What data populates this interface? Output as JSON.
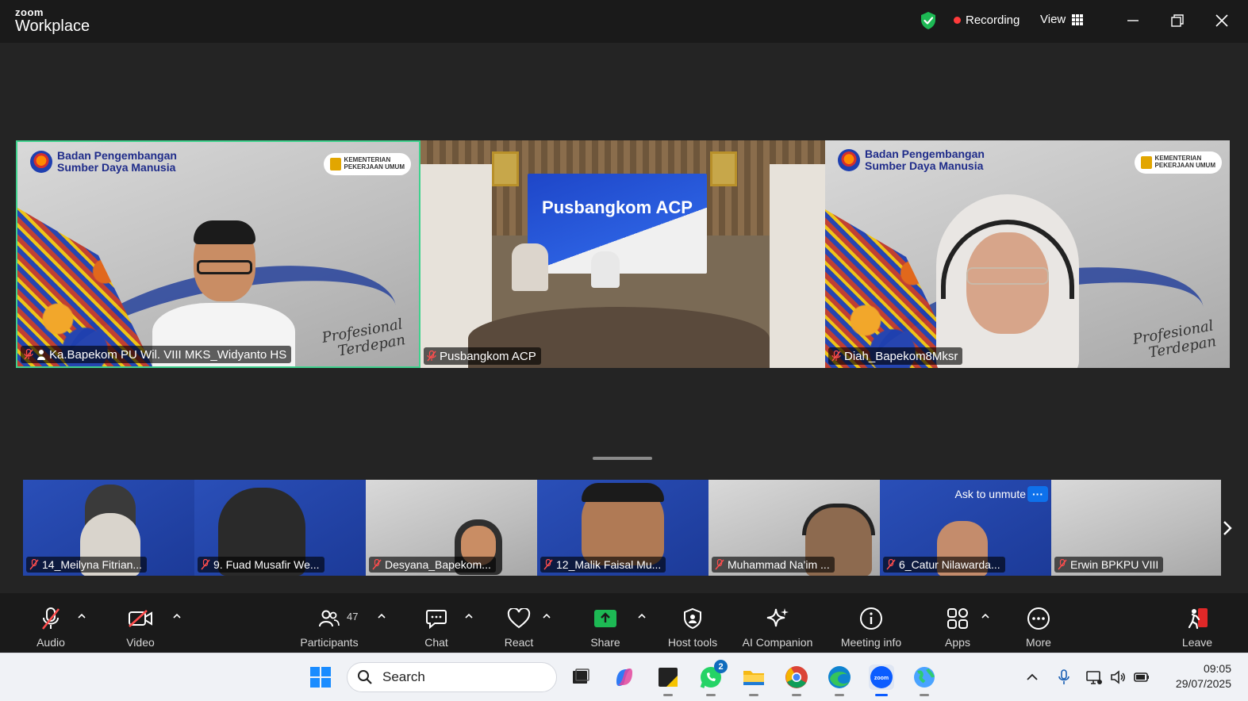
{
  "app": {
    "brand_top": "zoom",
    "brand_bottom": "Workplace"
  },
  "titlebar": {
    "recording_label": "Recording",
    "view_label": "View"
  },
  "stage": {
    "tiles": [
      {
        "name": "Ka.Bapekom PU Wil. VIII MKS_Widyanto HS",
        "active_speaker": true
      },
      {
        "name": "Pusbangkom ACP"
      },
      {
        "name": "Diah_Bapekom8Mksr"
      }
    ],
    "bpsdm_line1": "Badan Pengembangan",
    "bpsdm_line2": "Sumber Daya Manusia",
    "kemen_line1": "KEMENTERIAN",
    "kemen_line2": "PEKERJAAN UMUM",
    "banner_title": "Pusbangkom ACP",
    "signature_line1": "Profesional",
    "signature_line2": "Terdepan"
  },
  "strip": {
    "tiles": [
      {
        "name": "14_Meilyna Fitrian..."
      },
      {
        "name": "9. Fuad Musafir We..."
      },
      {
        "name": "Desyana_Bapekom..."
      },
      {
        "name": "12_Malik Faisal Mu..."
      },
      {
        "name": "Muhammad Na'im ..."
      },
      {
        "name": "6_Catur Nilawarda..."
      },
      {
        "name": "Erwin BPKPU VIII"
      }
    ],
    "ask_to_unmute": "Ask to unmute",
    "more_dots": "···"
  },
  "toolbar": {
    "audio": "Audio",
    "video": "Video",
    "participants": "Participants",
    "participants_count": "47",
    "chat": "Chat",
    "react": "React",
    "share": "Share",
    "host_tools": "Host tools",
    "ai_companion": "AI Companion",
    "meeting_info": "Meeting info",
    "apps": "Apps",
    "more": "More",
    "leave": "Leave"
  },
  "taskbar": {
    "search_placeholder": "Search",
    "whatsapp_badge": "2",
    "time": "09:05",
    "date": "29/07/2025"
  },
  "colors": {
    "accent_green": "#3fd18d",
    "zoom_blue": "#0e71eb",
    "recording_red": "#ff3b3b"
  }
}
